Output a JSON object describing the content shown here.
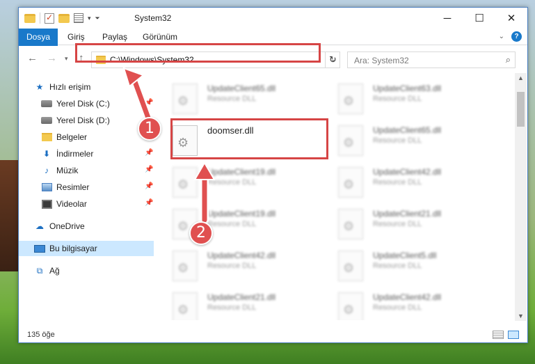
{
  "window": {
    "title": "System32"
  },
  "ribbon": {
    "tabs": [
      "Dosya",
      "Giriş",
      "Paylaş",
      "Görünüm"
    ],
    "help": "?"
  },
  "address": {
    "path": "C:\\Windows\\System32"
  },
  "search": {
    "placeholder": "Ara: System32"
  },
  "sidebar": {
    "items": [
      {
        "label": "Hızlı erişim",
        "icon": "quick-access-star-icon"
      },
      {
        "label": "Yerel Disk (C:)",
        "icon": "drive-icon"
      },
      {
        "label": "Yerel Disk (D:)",
        "icon": "drive-icon"
      },
      {
        "label": "Belgeler",
        "icon": "documents-folder-icon"
      },
      {
        "label": "İndirmeler",
        "icon": "downloads-icon"
      },
      {
        "label": "Müzik",
        "icon": "music-icon"
      },
      {
        "label": "Resimler",
        "icon": "pictures-icon"
      },
      {
        "label": "Videolar",
        "icon": "videos-icon"
      },
      {
        "label": "OneDrive",
        "icon": "onedrive-icon"
      },
      {
        "label": "Bu bilgisayar",
        "icon": "this-pc-icon"
      },
      {
        "label": "Ağ",
        "icon": "network-icon"
      }
    ]
  },
  "files": [
    {
      "name": "UpdateClient65.dll",
      "desc": "Resource DLL"
    },
    {
      "name": "UpdateClient63.dll",
      "desc": "Resource DLL"
    },
    {
      "name": "doomser.dll",
      "desc": ""
    },
    {
      "name": "UpdateClient65.dll",
      "desc": "Resource DLL"
    },
    {
      "name": "UpdateClient19.dll",
      "desc": "Resource DLL"
    },
    {
      "name": "UpdateClient42.dll",
      "desc": "Resource DLL"
    },
    {
      "name": "UpdateClient19.dll",
      "desc": "Resource DLL"
    },
    {
      "name": "UpdateClient21.dll",
      "desc": "Resource DLL"
    },
    {
      "name": "UpdateClient42.dll",
      "desc": "Resource DLL"
    },
    {
      "name": "UpdateClient5.dll",
      "desc": "Resource DLL"
    },
    {
      "name": "UpdateClient21.dll",
      "desc": "Resource DLL"
    },
    {
      "name": "UpdateClient42.dll",
      "desc": "Resource DLL"
    }
  ],
  "status": {
    "count": "135 öğe"
  },
  "annotations": {
    "step1": "1",
    "step2": "2"
  },
  "colors": {
    "accent": "#1979ca",
    "highlight": "#d64545",
    "selected": "#cce8ff"
  }
}
